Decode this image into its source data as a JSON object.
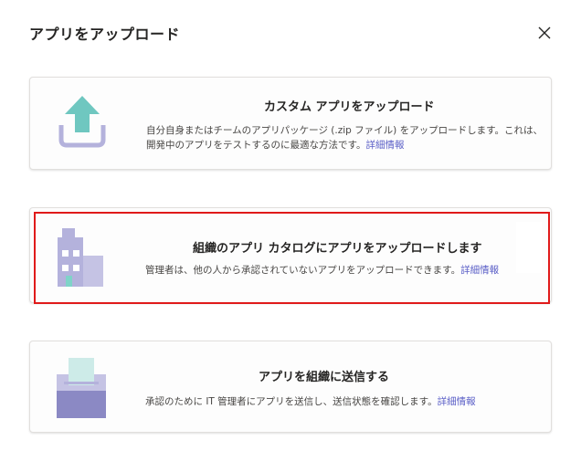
{
  "dialog": {
    "title": "アプリをアップロード",
    "close_icon": "close-icon"
  },
  "options": [
    {
      "title": "カスタム アプリをアップロード",
      "description": "自分自身またはチームのアプリパッケージ (.zip ファイル) をアップロードします。これは、開発中のアプリをテストするのに最適な方法です。",
      "link": "詳細情報",
      "icon": "upload-icon"
    },
    {
      "title": "組織のアプリ カタログにアプリをアップロードします",
      "description": "管理者は、他の人から承認されていないアプリをアップロードできます。",
      "link": "詳細情報",
      "icon": "building-icon"
    },
    {
      "title": "アプリを組織に送信する",
      "description": "承認のために IT 管理者にアプリを送信し、送信状態を確認します。",
      "link": "詳細情報",
      "icon": "submit-inbox-icon"
    }
  ],
  "colors": {
    "accent": "#5b5fc7",
    "highlight_border": "#e01a1a",
    "upload_arrow": "#6fc7c0",
    "building": "#b4b2dc",
    "tray": "#8b89c4"
  }
}
